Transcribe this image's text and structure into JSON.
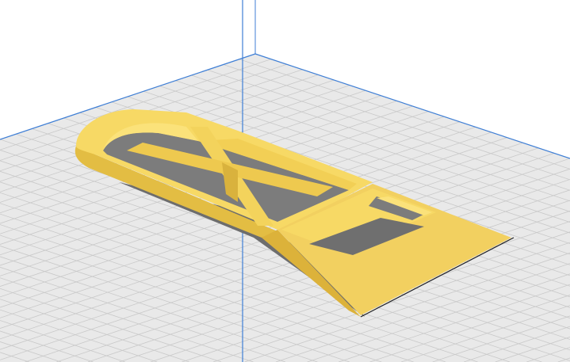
{
  "viewport": {
    "type": "3d-build-plate-view",
    "colors": {
      "background": "#ffffff",
      "plate": "#e9e9e9",
      "grid": "#c9c9c9",
      "axis": "#3f7fd6",
      "model_top": "#f7d965",
      "model_side": "#e3bd43",
      "model_inner": "#fbe27a",
      "shadow": "#6d6d6d",
      "hole": "#7c7c7c"
    }
  }
}
